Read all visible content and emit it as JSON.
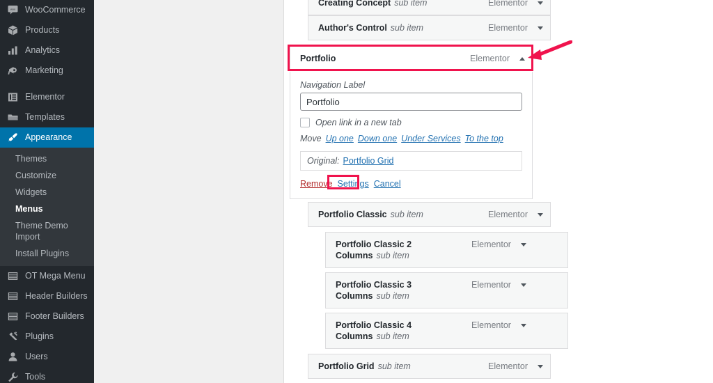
{
  "sidebar": {
    "items": [
      {
        "label": "WooCommerce",
        "icon": "woocommerce-icon",
        "current": false
      },
      {
        "label": "Products",
        "icon": "products-box-icon",
        "current": false
      },
      {
        "label": "Analytics",
        "icon": "analytics-bar-chart-icon",
        "current": false
      },
      {
        "label": "Marketing",
        "icon": "marketing-megaphone-icon",
        "current": false
      },
      {
        "label": "Elementor",
        "icon": "elementor-icon",
        "current": false
      },
      {
        "label": "Templates",
        "icon": "templates-folder-icon",
        "current": false
      },
      {
        "label": "Appearance",
        "icon": "appearance-brush-icon",
        "current": true
      },
      {
        "label": "OT Mega Menu",
        "icon": "mega-menu-icon",
        "current": false
      },
      {
        "label": "Header Builders",
        "icon": "header-builder-icon",
        "current": false
      },
      {
        "label": "Footer Builders",
        "icon": "footer-builder-icon",
        "current": false
      },
      {
        "label": "Plugins",
        "icon": "plugins-plug-icon",
        "current": false
      },
      {
        "label": "Users",
        "icon": "users-icon",
        "current": false
      },
      {
        "label": "Tools",
        "icon": "tools-wrench-icon",
        "current": false
      }
    ],
    "appearance_submenu": [
      {
        "label": "Themes",
        "current": false
      },
      {
        "label": "Customize",
        "current": false
      },
      {
        "label": "Widgets",
        "current": false
      },
      {
        "label": "Menus",
        "current": true
      },
      {
        "label": "Theme Demo Import",
        "current": false
      },
      {
        "label": "Install Plugins",
        "current": false
      }
    ]
  },
  "menu_rows": [
    {
      "title": "Creating Concept",
      "type": "sub item",
      "origin": "Elementor",
      "caret": "down",
      "indent": 0,
      "partial": true
    },
    {
      "title": "Author's Control",
      "type": "sub item",
      "origin": "Elementor",
      "caret": "down",
      "indent": 0,
      "partial": false
    },
    {
      "title": "Portfolio",
      "type": "",
      "origin": "Elementor",
      "caret": "up",
      "indent": 0,
      "partial": false,
      "expanded": true,
      "highlighted": true
    },
    {
      "title": "Portfolio Classic",
      "type": "sub item",
      "origin": "Elementor",
      "caret": "down",
      "indent": 1,
      "partial": false
    },
    {
      "title": "Portfolio Classic 2 Columns",
      "type": "sub item",
      "origin": "Elementor",
      "caret": "down",
      "indent": 2,
      "partial": false
    },
    {
      "title": "Portfolio Classic 3 Columns",
      "type": "sub item",
      "origin": "Elementor",
      "caret": "down",
      "indent": 2,
      "partial": false
    },
    {
      "title": "Portfolio Classic 4 Columns",
      "type": "sub item",
      "origin": "Elementor",
      "caret": "down",
      "indent": 2,
      "partial": false
    },
    {
      "title": "Portfolio Grid",
      "type": "sub item",
      "origin": "Elementor",
      "caret": "down",
      "indent": 1,
      "partial": false
    }
  ],
  "panel": {
    "nav_label_caption": "Navigation Label",
    "nav_label_value": "Portfolio",
    "new_tab_label": "Open link in a new tab",
    "new_tab_checked": false,
    "move_caption": "Move",
    "move_links": [
      "Up one",
      "Down one",
      "Under Services",
      "To the top"
    ],
    "original_caption": "Original:",
    "original_link": "Portfolio Grid",
    "remove_label": "Remove",
    "settings_label": "Settings",
    "cancel_label": "Cancel"
  },
  "colors": {
    "annotation_red": "#f0134d",
    "admin_blue": "#0073aa",
    "sidebar_bg": "#23282d",
    "submenu_bg": "#32373c",
    "link_blue": "#2271b1",
    "remove_red": "#b32d2e"
  }
}
